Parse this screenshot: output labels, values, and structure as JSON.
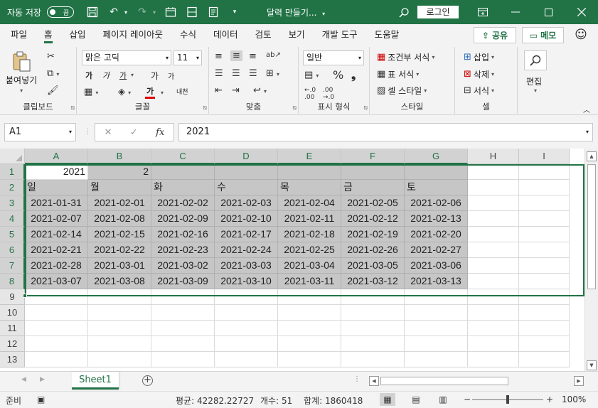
{
  "titlebar": {
    "autosave_label": "자동 저장",
    "autosave_state": "끔",
    "doc_title": "달력 만들기...",
    "login_label": "로그인"
  },
  "menu": {
    "tabs": [
      "파일",
      "홈",
      "삽입",
      "페이지 레이아웃",
      "수식",
      "데이터",
      "검토",
      "보기",
      "개발 도구",
      "도움말"
    ],
    "active_tab": "홈",
    "share_label": "공유",
    "memo_label": "메모"
  },
  "ribbon": {
    "clipboard": {
      "label": "클립보드",
      "paste": "붙여넣기"
    },
    "font": {
      "label": "글꼴",
      "font_name": "맑은 고딕",
      "font_size": "11",
      "bold": "가",
      "italic": "가",
      "underline": "가",
      "grow": "가",
      "shrink": "가",
      "font_color_glyph": "가",
      "phonetic": "내천"
    },
    "alignment": {
      "label": "맞춤"
    },
    "number": {
      "label": "표시 형식",
      "format": "일반"
    },
    "styles": {
      "label": "스타일",
      "conditional": "조건부 서식",
      "table": "표 서식",
      "cell_style": "셀 스타일"
    },
    "cells": {
      "label": "셀",
      "insert": "삽입",
      "delete": "삭제",
      "format": "서식"
    },
    "editing": {
      "label": "편집"
    }
  },
  "formula_bar": {
    "name_box": "A1",
    "value": "2021"
  },
  "grid": {
    "columns": [
      "A",
      "B",
      "C",
      "D",
      "E",
      "F",
      "G",
      "H",
      "I"
    ],
    "rows": [
      "1",
      "2",
      "3",
      "4",
      "5",
      "6",
      "7",
      "8",
      "9",
      "10",
      "11",
      "12",
      "13"
    ],
    "cells": {
      "r1": [
        "2021",
        "2",
        "",
        "",
        "",
        "",
        "",
        "",
        ""
      ],
      "r2": [
        "일",
        "월",
        "화",
        "수",
        "목",
        "금",
        "토",
        "",
        ""
      ],
      "r3": [
        "2021-01-31",
        "2021-02-01",
        "2021-02-02",
        "2021-02-03",
        "2021-02-04",
        "2021-02-05",
        "2021-02-06",
        "",
        ""
      ],
      "r4": [
        "2021-02-07",
        "2021-02-08",
        "2021-02-09",
        "2021-02-10",
        "2021-02-11",
        "2021-02-12",
        "2021-02-13",
        "",
        ""
      ],
      "r5": [
        "2021-02-14",
        "2021-02-15",
        "2021-02-16",
        "2021-02-17",
        "2021-02-18",
        "2021-02-19",
        "2021-02-20",
        "",
        ""
      ],
      "r6": [
        "2021-02-21",
        "2021-02-22",
        "2021-02-23",
        "2021-02-24",
        "2021-02-25",
        "2021-02-26",
        "2021-02-27",
        "",
        ""
      ],
      "r7": [
        "2021-02-28",
        "2021-03-01",
        "2021-03-02",
        "2021-03-03",
        "2021-03-04",
        "2021-03-05",
        "2021-03-06",
        "",
        ""
      ],
      "r8": [
        "2021-03-07",
        "2021-03-08",
        "2021-03-09",
        "2021-03-10",
        "2021-03-11",
        "2021-03-12",
        "2021-03-13",
        "",
        ""
      ]
    }
  },
  "sheets": {
    "active": "Sheet1"
  },
  "status": {
    "ready": "준비",
    "average_label": "평균: 42282.22727",
    "count_label": "개수: 51",
    "sum_label": "합계: 1860418",
    "zoom": "100%"
  },
  "colors": {
    "accent": "#217346",
    "selection": "#c6c6c6"
  }
}
